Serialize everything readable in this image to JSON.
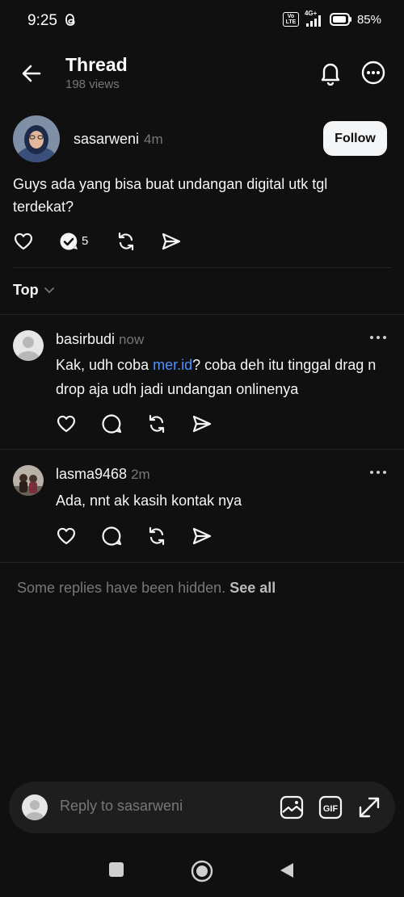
{
  "status_bar": {
    "time": "9:25",
    "network": "4G+",
    "volte": "Vo LTE",
    "battery": "85%"
  },
  "header": {
    "title": "Thread",
    "views": "198 views"
  },
  "post": {
    "username": "sasarweni",
    "time": "4m",
    "follow_label": "Follow",
    "text": "Guys ada yang bisa buat undangan digital  utk tgl terdekat?",
    "reply_count": "5"
  },
  "sort": {
    "label": "Top"
  },
  "replies": [
    {
      "username": "basirbudi",
      "time": "now",
      "text_before": "Kak, udh coba ",
      "link": "mer.id",
      "text_after": "? coba deh itu tinggal drag n drop aja udh jadi undangan onlinenya"
    },
    {
      "username": "lasma9468",
      "time": "2m",
      "text": "Ada, nnt ak kasih kontak nya"
    }
  ],
  "hidden_note": {
    "text": "Some replies have been hidden.",
    "see_all": "See all"
  },
  "composer": {
    "placeholder": "Reply to sasarweni",
    "gif_label": "GIF"
  },
  "colors": {
    "background": "#101010",
    "text": "#f3f5f7",
    "muted": "#777777",
    "link": "#4f91ff",
    "composer_bg": "#1e1e1e"
  }
}
